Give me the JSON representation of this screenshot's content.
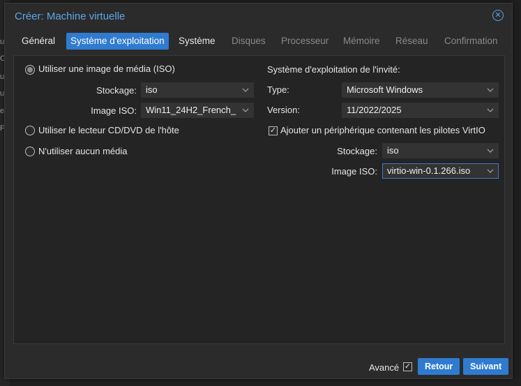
{
  "background_strip": [
    "ur",
    "CD",
    "ur",
    "ur",
    "ea",
    "FI"
  ],
  "dialog": {
    "title": "Créer: Machine virtuelle",
    "close_icon": "close-circle-icon"
  },
  "tabs": [
    {
      "label": "Général",
      "state": "normal"
    },
    {
      "label": "Système d'exploitation",
      "state": "active"
    },
    {
      "label": "Système",
      "state": "normal"
    },
    {
      "label": "Disques",
      "state": "disabled"
    },
    {
      "label": "Processeur",
      "state": "disabled"
    },
    {
      "label": "Mémoire",
      "state": "disabled"
    },
    {
      "label": "Réseau",
      "state": "disabled"
    },
    {
      "label": "Confirmation",
      "state": "disabled"
    }
  ],
  "left": {
    "radio_iso": "Utiliser une image de média (ISO)",
    "storage_label": "Stockage:",
    "storage_value": "iso",
    "iso_label": "Image ISO:",
    "iso_value": "Win11_24H2_French_",
    "radio_cd": "Utiliser le lecteur CD/DVD de l'hôte",
    "radio_none": "N'utiliser aucun média"
  },
  "right": {
    "section_title": "Système d'exploitation de l'invité:",
    "type_label": "Type:",
    "type_value": "Microsoft Windows",
    "version_label": "Version:",
    "version_value": "11/2022/2025",
    "virtio_checkbox": "Ajouter un périphérique contenant les pilotes VirtIO",
    "storage_label": "Stockage:",
    "storage_value": "iso",
    "iso_label": "Image ISO:",
    "iso_value": "virtio-win-0.1.266.iso"
  },
  "footer": {
    "advanced_label": "Avancé",
    "back_button": "Retour",
    "next_button": "Suivant"
  },
  "colors": {
    "accent": "#2f7bd0",
    "title": "#5ea6e8",
    "annotation": "#d3131e"
  }
}
